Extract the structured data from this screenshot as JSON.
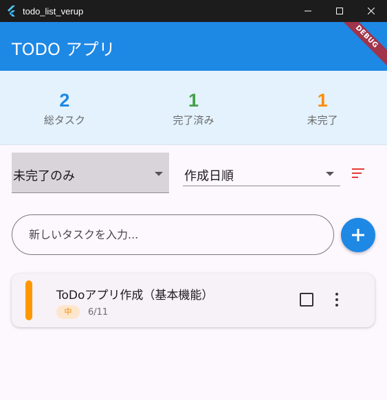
{
  "window": {
    "title": "todo_list_verup"
  },
  "appbar": {
    "title": "TODO アプリ",
    "debug_label": "DEBUG",
    "color": "#1e88e5"
  },
  "stats": [
    {
      "value": "2",
      "label": "総タスク",
      "color": "#1e88e5"
    },
    {
      "value": "1",
      "label": "完了済み",
      "color": "#43a047"
    },
    {
      "value": "1",
      "label": "未完了",
      "color": "#fb8c00"
    }
  ],
  "filter": {
    "selected": "未完了のみ"
  },
  "sort": {
    "selected": "作成日順",
    "icon": "sort-icon",
    "icon_color": "#e53935"
  },
  "input": {
    "placeholder": "新しいタスクを入力...",
    "value": ""
  },
  "tasks": [
    {
      "title": "ToDoアプリ作成（基本機能）",
      "priority": "中",
      "priority_color": "#ff9800",
      "date": "6/11",
      "completed": false
    }
  ]
}
